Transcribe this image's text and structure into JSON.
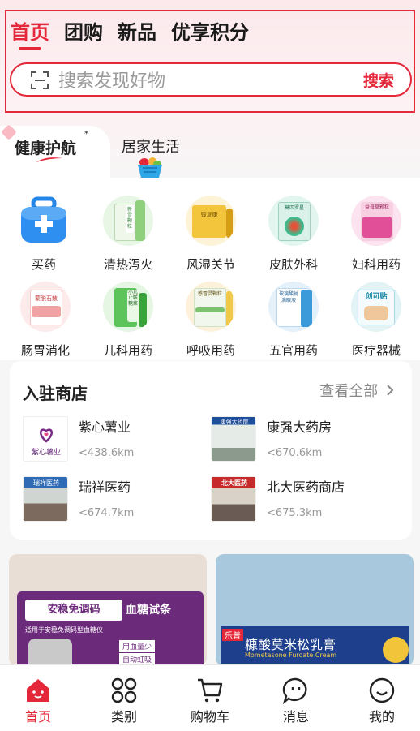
{
  "header": {
    "tabs": [
      {
        "label": "首页",
        "active": true
      },
      {
        "label": "团购",
        "active": false
      },
      {
        "label": "新品",
        "active": false
      },
      {
        "label": "优享积分",
        "active": false
      }
    ],
    "search": {
      "placeholder": "搜索发现好物",
      "button": "搜索"
    }
  },
  "category_tabs": {
    "active": "健康护航",
    "star": "*",
    "second": "居家生活"
  },
  "grid": [
    {
      "label": "买药",
      "icon": "medicine-kit-icon",
      "pack_text": ""
    },
    {
      "label": "清热泻火",
      "icon": "heat-clearing-box-icon",
      "pack_text": "新雪颗粒"
    },
    {
      "label": "风湿关节",
      "icon": "rheumatism-box-icon",
      "pack_text": "颈复康"
    },
    {
      "label": "皮肤外科",
      "icon": "skin-box-icon",
      "pack_text": "莫匹罗星"
    },
    {
      "label": "妇科用药",
      "icon": "gynecology-box-icon",
      "pack_text": "益母草颗粒"
    },
    {
      "label": "肠胃消化",
      "icon": "digestive-box-icon",
      "pack_text": "蒙脱石散"
    },
    {
      "label": "儿科用药",
      "icon": "pediatric-box-icon",
      "pack_text": "小儿止咳糖浆"
    },
    {
      "label": "呼吸用药",
      "icon": "respiratory-box-icon",
      "pack_text": "感冒灵颗粒"
    },
    {
      "label": "五官用药",
      "icon": "ent-box-icon",
      "pack_text": "玻璃酸钠滴眼液"
    },
    {
      "label": "医疗器械",
      "icon": "medical-device-box-icon",
      "pack_text": "创可贴"
    }
  ],
  "shops": {
    "title": "入驻商店",
    "more": "查看全部",
    "items": [
      {
        "name": "紫心薯业",
        "distance": "<438.6km",
        "thumb_text": "紫心薯业"
      },
      {
        "name": "康强大药房",
        "distance": "<670.6km",
        "thumb_text": "康强大药房"
      },
      {
        "name": "瑞祥医药",
        "distance": "<674.7km",
        "thumb_text": "瑞祥医药"
      },
      {
        "name": "北大医药商店",
        "distance": "<675.3km",
        "thumb_text": "北大医药"
      }
    ]
  },
  "promos": [
    {
      "brand": "安稳免调码",
      "product": "血糖试条",
      "sub": "适用于安稳免调码型血糖仪",
      "tags": [
        "用血量少",
        "自动虹吸"
      ]
    },
    {
      "brand": "乐普",
      "product": "糠酸莫米松乳膏",
      "sub": "Mometasone Furoate Cream"
    }
  ],
  "tabbar": [
    {
      "label": "首页",
      "icon": "home-icon",
      "active": true
    },
    {
      "label": "类别",
      "icon": "category-grid-icon",
      "active": false
    },
    {
      "label": "购物车",
      "icon": "cart-icon",
      "active": false
    },
    {
      "label": "消息",
      "icon": "message-icon",
      "active": false
    },
    {
      "label": "我的",
      "icon": "profile-icon",
      "active": false
    }
  ],
  "colors": {
    "accent": "#e4283a",
    "background": "#f6f6f6"
  }
}
